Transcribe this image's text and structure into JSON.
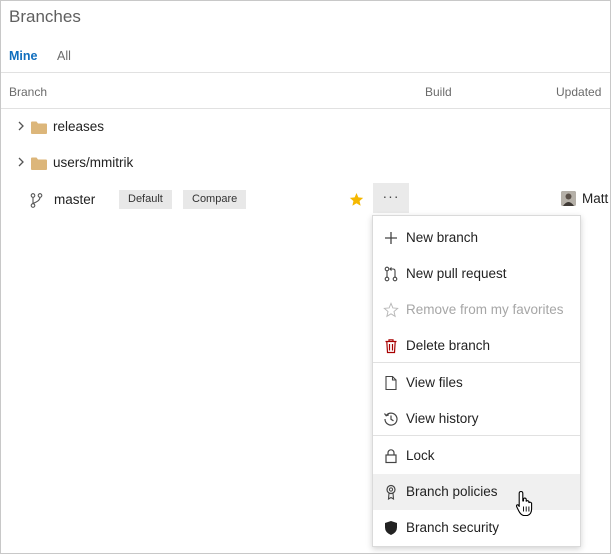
{
  "page": {
    "title": "Branches"
  },
  "tabs": [
    {
      "label": "Mine",
      "selected": true
    },
    {
      "label": "All",
      "selected": false
    }
  ],
  "columns": {
    "branch": "Branch",
    "build": "Build",
    "updated": "Updated"
  },
  "rows": [
    {
      "type": "folder",
      "label": "releases",
      "expanded": false
    },
    {
      "type": "folder",
      "label": "users/mmitrik",
      "expanded": false
    },
    {
      "type": "branch",
      "label": "master",
      "badges": [
        "Default",
        "Compare"
      ],
      "favorite": true,
      "more_label": "···",
      "updated_by": "Matt"
    }
  ],
  "context_menu": {
    "items": [
      {
        "label": "New branch",
        "icon": "plus-icon",
        "disabled": false
      },
      {
        "label": "New pull request",
        "icon": "pull-request-icon",
        "disabled": false
      },
      {
        "label": "Remove from my favorites",
        "icon": "star-outline-icon",
        "disabled": true
      },
      {
        "label": "Delete branch",
        "icon": "trash-icon",
        "disabled": false
      },
      {
        "label": "View files",
        "icon": "file-icon",
        "disabled": false
      },
      {
        "label": "View history",
        "icon": "history-icon",
        "disabled": false
      },
      {
        "label": "Lock",
        "icon": "lock-icon",
        "disabled": false
      },
      {
        "label": "Branch policies",
        "icon": "policy-badge-icon",
        "disabled": false,
        "hovered": true
      },
      {
        "label": "Branch security",
        "icon": "shield-icon",
        "disabled": false
      }
    ]
  },
  "colors": {
    "accent": "#106ebe",
    "star": "#f5b800",
    "folder": "#dcb67a",
    "delete": "#a80000",
    "hover": "#f0f0f0"
  }
}
